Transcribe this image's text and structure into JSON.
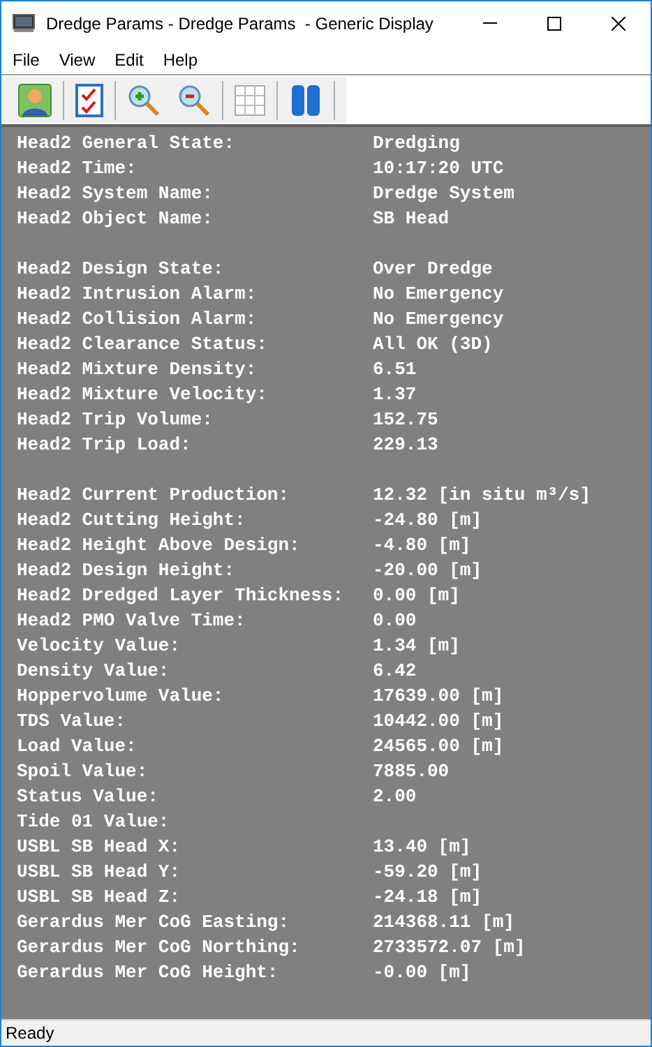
{
  "window": {
    "title": "Dredge Params - Dredge Params  - Generic Display"
  },
  "menu": [
    "File",
    "View",
    "Edit",
    "Help"
  ],
  "groups": [
    [
      {
        "label": "Head2 General State:",
        "value": "Dredging"
      },
      {
        "label": "Head2 Time:",
        "value": "10:17:20 UTC"
      },
      {
        "label": "Head2 System Name:",
        "value": "Dredge System"
      },
      {
        "label": "Head2 Object Name:",
        "value": "SB Head"
      }
    ],
    [
      {
        "label": "Head2 Design State:",
        "value": "Over Dredge"
      },
      {
        "label": "Head2 Intrusion Alarm:",
        "value": "No Emergency"
      },
      {
        "label": "Head2 Collision Alarm:",
        "value": "No Emergency"
      },
      {
        "label": "Head2 Clearance Status:",
        "value": "All OK (3D)"
      },
      {
        "label": "Head2 Mixture Density:",
        "value": "6.51"
      },
      {
        "label": "Head2 Mixture Velocity:",
        "value": "1.37"
      },
      {
        "label": "Head2 Trip Volume:",
        "value": "152.75"
      },
      {
        "label": "Head2 Trip Load:",
        "value": "229.13"
      }
    ],
    [
      {
        "label": "Head2 Current Production:",
        "value": "12.32 [in situ m³/s]"
      },
      {
        "label": "Head2 Cutting Height:",
        "value": "-24.80 [m]"
      },
      {
        "label": "Head2 Height Above Design:",
        "value": "-4.80 [m]"
      },
      {
        "label": "Head2 Design Height:",
        "value": "-20.00 [m]"
      },
      {
        "label": "Head2 Dredged Layer Thickness:",
        "value": "0.00 [m]"
      },
      {
        "label": "Head2 PMO Valve Time:",
        "value": "0.00"
      },
      {
        "label": "Velocity Value:",
        "value": "1.34 [m]"
      },
      {
        "label": "Density Value:",
        "value": "6.42"
      },
      {
        "label": "Hoppervolume Value:",
        "value": "17639.00 [m]"
      },
      {
        "label": "TDS Value:",
        "value": "10442.00 [m]"
      },
      {
        "label": "Load Value:",
        "value": "24565.00 [m]"
      },
      {
        "label": "Spoil Value:",
        "value": "7885.00"
      },
      {
        "label": "Status Value:",
        "value": "2.00"
      },
      {
        "label": "Tide 01 Value:"
      },
      {
        "label": "USBL SB Head X:",
        "value": "13.40 [m]"
      },
      {
        "label": "USBL SB Head Y:",
        "value": "-59.20 [m]"
      },
      {
        "label": "USBL SB Head Z:",
        "value": "-24.18 [m]"
      },
      {
        "label": "Gerardus Mer CoG Easting:",
        "value": "214368.11 [m]"
      },
      {
        "label": "Gerardus Mer CoG Northing:",
        "value": "2733572.07 [m]"
      },
      {
        "label": "Gerardus Mer CoG Height:",
        "value": "-0.00 [m]"
      }
    ]
  ],
  "status_bar": "Ready"
}
